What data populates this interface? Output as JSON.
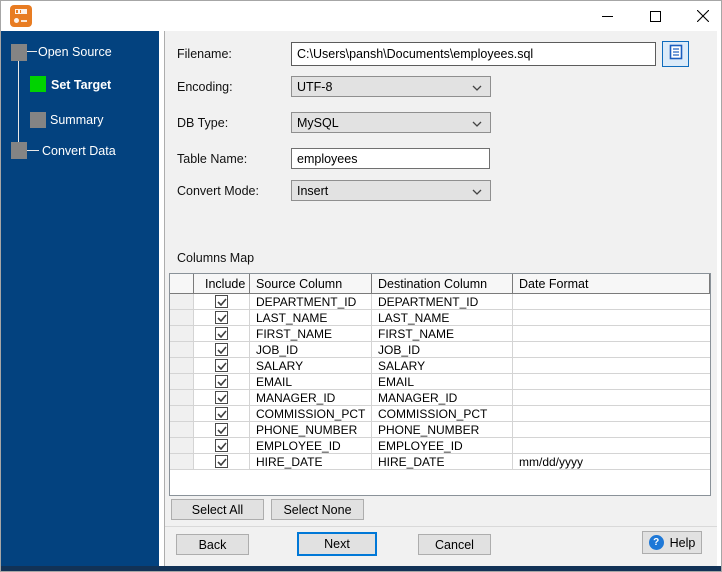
{
  "window": {
    "title": "",
    "controls": {
      "minimize_icon": "minimize",
      "maximize_icon": "maximize",
      "close_icon": "close"
    },
    "app_icon": "orange-db-app-icon"
  },
  "colors": {
    "sidebar_bg": "#03427f",
    "active_step_green": "#00d300",
    "inactive_step_gray": "#848484",
    "focus_blue": "#0078d7",
    "help_icon_blue": "#1e78d7"
  },
  "sidebar": {
    "steps": [
      {
        "label": "Open Source",
        "state": "done"
      },
      {
        "label": "Set Target",
        "state": "active"
      },
      {
        "label": "Summary",
        "state": "pending"
      },
      {
        "label": "Convert Data",
        "state": "pending"
      }
    ]
  },
  "form": {
    "filename_label": "Filename:",
    "filename_value": "C:\\Users\\pansh\\Documents\\employees.sql",
    "browse_icon": "file-document-icon",
    "encoding_label": "Encoding:",
    "encoding_value": "UTF-8",
    "dbtype_label": "DB Type:",
    "dbtype_value": "MySQL",
    "tablename_label": "Table Name:",
    "tablename_value": "employees",
    "convertmode_label": "Convert Mode:",
    "convertmode_value": "Insert"
  },
  "columns_map": {
    "title": "Columns Map",
    "headers": {
      "include": "Include",
      "source": "Source Column",
      "destination": "Destination Column",
      "date_format": "Date Format"
    },
    "rows": [
      {
        "include": true,
        "source": "DEPARTMENT_ID",
        "destination": "DEPARTMENT_ID",
        "date_format": ""
      },
      {
        "include": true,
        "source": "LAST_NAME",
        "destination": "LAST_NAME",
        "date_format": ""
      },
      {
        "include": true,
        "source": "FIRST_NAME",
        "destination": "FIRST_NAME",
        "date_format": ""
      },
      {
        "include": true,
        "source": "JOB_ID",
        "destination": "JOB_ID",
        "date_format": ""
      },
      {
        "include": true,
        "source": "SALARY",
        "destination": "SALARY",
        "date_format": ""
      },
      {
        "include": true,
        "source": "EMAIL",
        "destination": "EMAIL",
        "date_format": ""
      },
      {
        "include": true,
        "source": "MANAGER_ID",
        "destination": "MANAGER_ID",
        "date_format": ""
      },
      {
        "include": true,
        "source": "COMMISSION_PCT",
        "destination": "COMMISSION_PCT",
        "date_format": ""
      },
      {
        "include": true,
        "source": "PHONE_NUMBER",
        "destination": "PHONE_NUMBER",
        "date_format": ""
      },
      {
        "include": true,
        "source": "EMPLOYEE_ID",
        "destination": "EMPLOYEE_ID",
        "date_format": ""
      },
      {
        "include": true,
        "source": "HIRE_DATE",
        "destination": "HIRE_DATE",
        "date_format": "mm/dd/yyyy"
      }
    ]
  },
  "buttons": {
    "select_all": "Select All",
    "select_none": "Select None",
    "back": "Back",
    "next": "Next",
    "cancel": "Cancel",
    "help": "Help",
    "help_icon": "?"
  }
}
